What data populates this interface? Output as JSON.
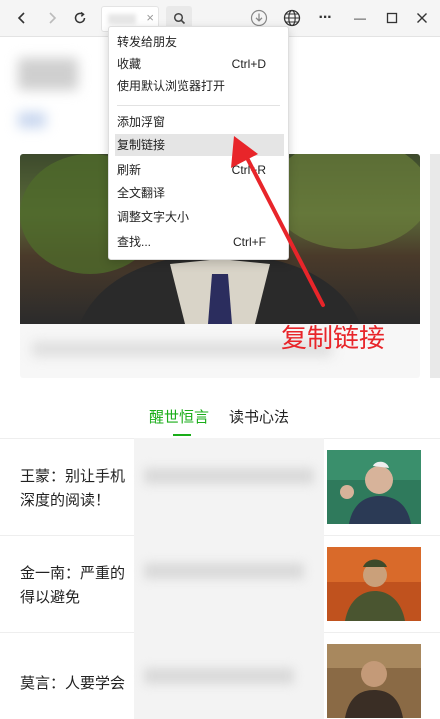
{
  "toolbar": {
    "back_icon": "chevron-left-icon",
    "forward_icon": "chevron-right-icon",
    "reload_icon": "reload-icon",
    "clear_glyph": "×",
    "search_icon": "search-icon",
    "download_icon": "download-icon",
    "globe_icon": "globe-icon",
    "more_icon": "more-icon",
    "more_glyph": "···",
    "minimize_glyph": "—",
    "maximize_glyph": "☐",
    "close_glyph": "✕"
  },
  "context_menu": {
    "items": [
      {
        "label": "转发给朋友",
        "shortcut": ""
      },
      {
        "label": "收藏",
        "shortcut": "Ctrl+D"
      },
      {
        "label": "使用默认浏览器打开",
        "shortcut": ""
      },
      {
        "label": "添加浮窗",
        "shortcut": ""
      },
      {
        "label": "复制链接",
        "shortcut": "",
        "highlighted": true
      },
      {
        "label": "刷新",
        "shortcut": "Ctrl+R"
      },
      {
        "label": "全文翻译",
        "shortcut": ""
      },
      {
        "label": "调整文字大小",
        "shortcut": ""
      },
      {
        "label": "查找...",
        "shortcut": "Ctrl+F"
      }
    ]
  },
  "annotation": {
    "text": "复制链接",
    "color": "#e8252a"
  },
  "tabs": [
    {
      "label": "醒世恒言",
      "active": true
    },
    {
      "label": "读书心法",
      "active": false
    }
  ],
  "accent_color": "#1aad19",
  "articles": [
    {
      "line1": "王蒙：别让手机",
      "line2": "深度的阅读！"
    },
    {
      "line1": "金一南：严重的",
      "line2": "得以避免"
    },
    {
      "line1": "莫言：人要学会",
      "line2": ""
    }
  ]
}
